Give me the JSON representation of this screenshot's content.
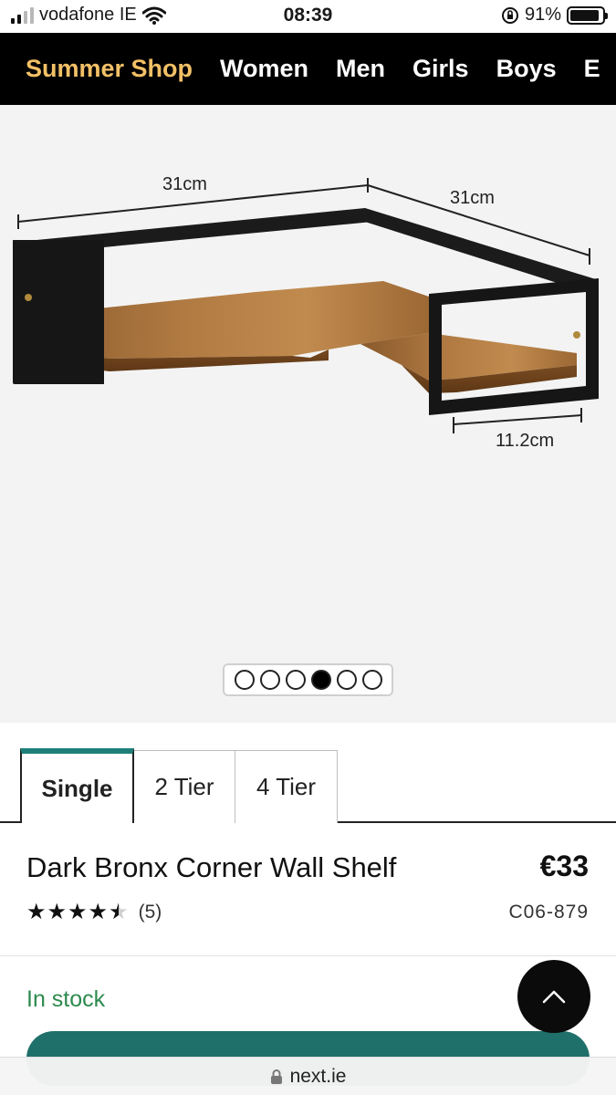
{
  "status_bar": {
    "carrier": "vodafone IE",
    "time": "08:39",
    "battery": "91%",
    "battery_level": 0.91
  },
  "nav": {
    "items": [
      "Summer Shop",
      "Women",
      "Men",
      "Girls",
      "Boys",
      "E"
    ]
  },
  "gallery": {
    "dimension_labels": [
      "31cm",
      "31cm",
      "11.2cm"
    ],
    "image_count": 6,
    "active_index": 3
  },
  "tabs": [
    {
      "label": "Single",
      "active": true
    },
    {
      "label": "2 Tier",
      "active": false
    },
    {
      "label": "4 Tier",
      "active": false
    }
  ],
  "product": {
    "title": "Dark Bronx Corner Wall Shelf",
    "price": "€33",
    "rating": 4.5,
    "review_count": "(5)",
    "sku": "C06-879",
    "stock": "In stock"
  },
  "browser": {
    "url": "next.ie"
  },
  "colors": {
    "accent": "#1e7f7a",
    "promo": "#f2c066",
    "stock": "#2d8a4e"
  }
}
